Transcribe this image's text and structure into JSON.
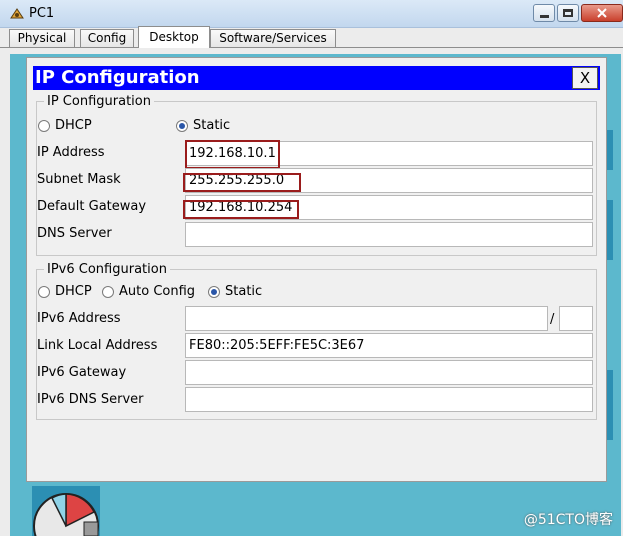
{
  "window": {
    "title": "PC1"
  },
  "tabs": [
    {
      "label": "Physical"
    },
    {
      "label": "Config"
    },
    {
      "label": "Desktop"
    },
    {
      "label": "Software/Services"
    }
  ],
  "dialog": {
    "title": "IP Configuration",
    "close_label": "X",
    "ipv4": {
      "group_label": "IP Configuration",
      "dhcp_label": "DHCP",
      "static_label": "Static",
      "selected": "Static",
      "ip_label": "IP Address",
      "ip_value": "192.168.10.1",
      "mask_label": "Subnet Mask",
      "mask_value": "255.255.255.0",
      "gateway_label": "Default Gateway",
      "gateway_value": "192.168.10.254",
      "dns_label": "DNS Server",
      "dns_value": ""
    },
    "ipv6": {
      "group_label": "IPv6 Configuration",
      "dhcp_label": "DHCP",
      "auto_label": "Auto Config",
      "static_label": "Static",
      "selected": "Static",
      "address_label": "IPv6 Address",
      "address_value": "",
      "slash": "/",
      "prefix_value": "",
      "link_local_label": "Link Local Address",
      "link_local_value": "FE80::205:5EFF:FE5C:3E67",
      "gateway_label": "IPv6 Gateway",
      "gateway_value": "",
      "dns_label": "IPv6 DNS Server",
      "dns_value": ""
    }
  },
  "watermark": "@51CTO博客",
  "colors": {
    "dialog_title_bg": "#0000ff",
    "highlight": "#9a1c1c",
    "desktop_bg": "#5cb8cd"
  }
}
